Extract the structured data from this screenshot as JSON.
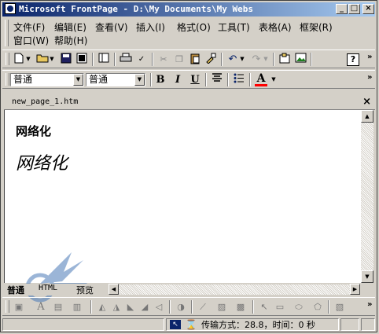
{
  "window": {
    "title": "Microsoft FrontPage - D:\\My Documents\\My Webs",
    "minimize": "_",
    "maximize": "□",
    "close": "×"
  },
  "menu": {
    "items": [
      "文件(F)",
      "编辑(E)",
      "查看(V)",
      "插入(I)",
      "格式(O)",
      "工具(T)",
      "表格(A)",
      "框架(R)",
      "窗口(W)",
      "帮助(H)"
    ]
  },
  "format_toolbar": {
    "style_value": "普通",
    "font_value": "普通",
    "bold": "B",
    "italic": "I",
    "underline": "U",
    "font_color": "A"
  },
  "document": {
    "tab_name": "new_page_1.htm",
    "close": "×",
    "heading_bold": "网络化",
    "heading_italic": "网络化"
  },
  "view_tabs": [
    "普通",
    "HTML",
    "预览"
  ],
  "status": {
    "transfer_text": "传输方式：28.8，时间：0 秒"
  },
  "colors": {
    "title_start": "#0a246a",
    "title_end": "#a6caf0",
    "font_color_bar": "#ff0000",
    "chrome": "#d4d0c8"
  }
}
